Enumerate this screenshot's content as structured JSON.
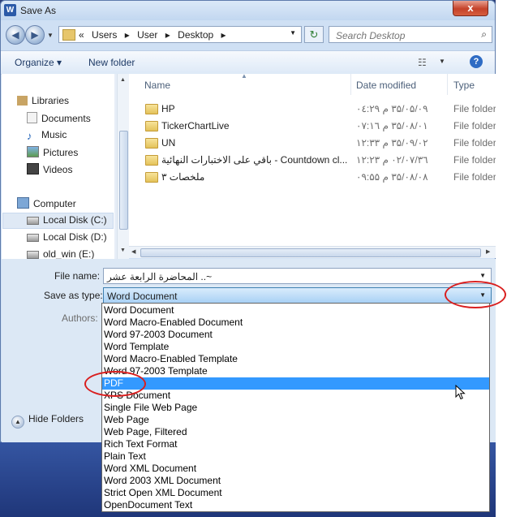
{
  "window": {
    "title": "Save As",
    "app_icon_letter": "W",
    "close_label": "x"
  },
  "address": {
    "path_prefix": "«",
    "crumbs": [
      "Users",
      "User",
      "Desktop"
    ],
    "separators": "▸"
  },
  "search": {
    "placeholder": "Search Desktop"
  },
  "toolbar": {
    "organize": "Organize ▾",
    "new_folder": "New folder",
    "help": "?"
  },
  "nav": {
    "items": [
      {
        "label": "Libraries",
        "icon": "library-icon"
      },
      {
        "label": "Documents",
        "icon": "documents-icon"
      },
      {
        "label": "Music",
        "icon": "music-icon"
      },
      {
        "label": "Pictures",
        "icon": "pictures-icon"
      },
      {
        "label": "Videos",
        "icon": "videos-icon"
      },
      {
        "label": "Computer",
        "icon": "computer-icon"
      },
      {
        "label": "Local Disk (C:)",
        "icon": "disk-icon"
      },
      {
        "label": "Local Disk (D:)",
        "icon": "disk-icon"
      },
      {
        "label": "old_win (E:)",
        "icon": "disk-icon"
      }
    ]
  },
  "files": {
    "columns": {
      "name": "Name",
      "date": "Date modified",
      "type": "Type"
    },
    "rows": [
      {
        "name": "HP",
        "date": "۳۵/۰۵/۰۹ م ۰٤:۲۹",
        "type": "File folder"
      },
      {
        "name": "TickerChartLive",
        "date": "۳۵/۰۸/۰۱ م ۰۷:۱٦",
        "type": "File folder"
      },
      {
        "name": "UN",
        "date": "۳۵/۰۹/۰۲ م ۱۲:۳۳",
        "type": "File folder"
      },
      {
        "name": "باقي على الاختبارات النهائية - Countdown cl...",
        "date": "۳٦/۰۲/۰۷ م ۱۲:۲۳",
        "type": "File folder"
      },
      {
        "name": "ملخصات ۳",
        "date": "۳۵/۰۸/۰۸ م ۰۹:۵۵",
        "type": "File folder"
      }
    ]
  },
  "form": {
    "file_name_label": "File name:",
    "file_name_value": "~.. المحاضرة الرابعة عشر",
    "save_type_label": "Save as type:",
    "save_type_value": "Word Document",
    "authors_label": "Authors:"
  },
  "hide_folders": "Hide Folders",
  "save_types": [
    "Word Document",
    "Word Macro-Enabled Document",
    "Word 97-2003 Document",
    "Word Template",
    "Word Macro-Enabled Template",
    "Word 97-2003 Template",
    "PDF",
    "XPS Document",
    "Single File Web Page",
    "Web Page",
    "Web Page, Filtered",
    "Rich Text Format",
    "Plain Text",
    "Word XML Document",
    "Word 2003 XML Document",
    "Strict Open XML Document",
    "OpenDocument Text"
  ],
  "highlighted_option": "PDF",
  "colors": {
    "highlight": "#3399ff",
    "annotation": "#d91f1f"
  }
}
